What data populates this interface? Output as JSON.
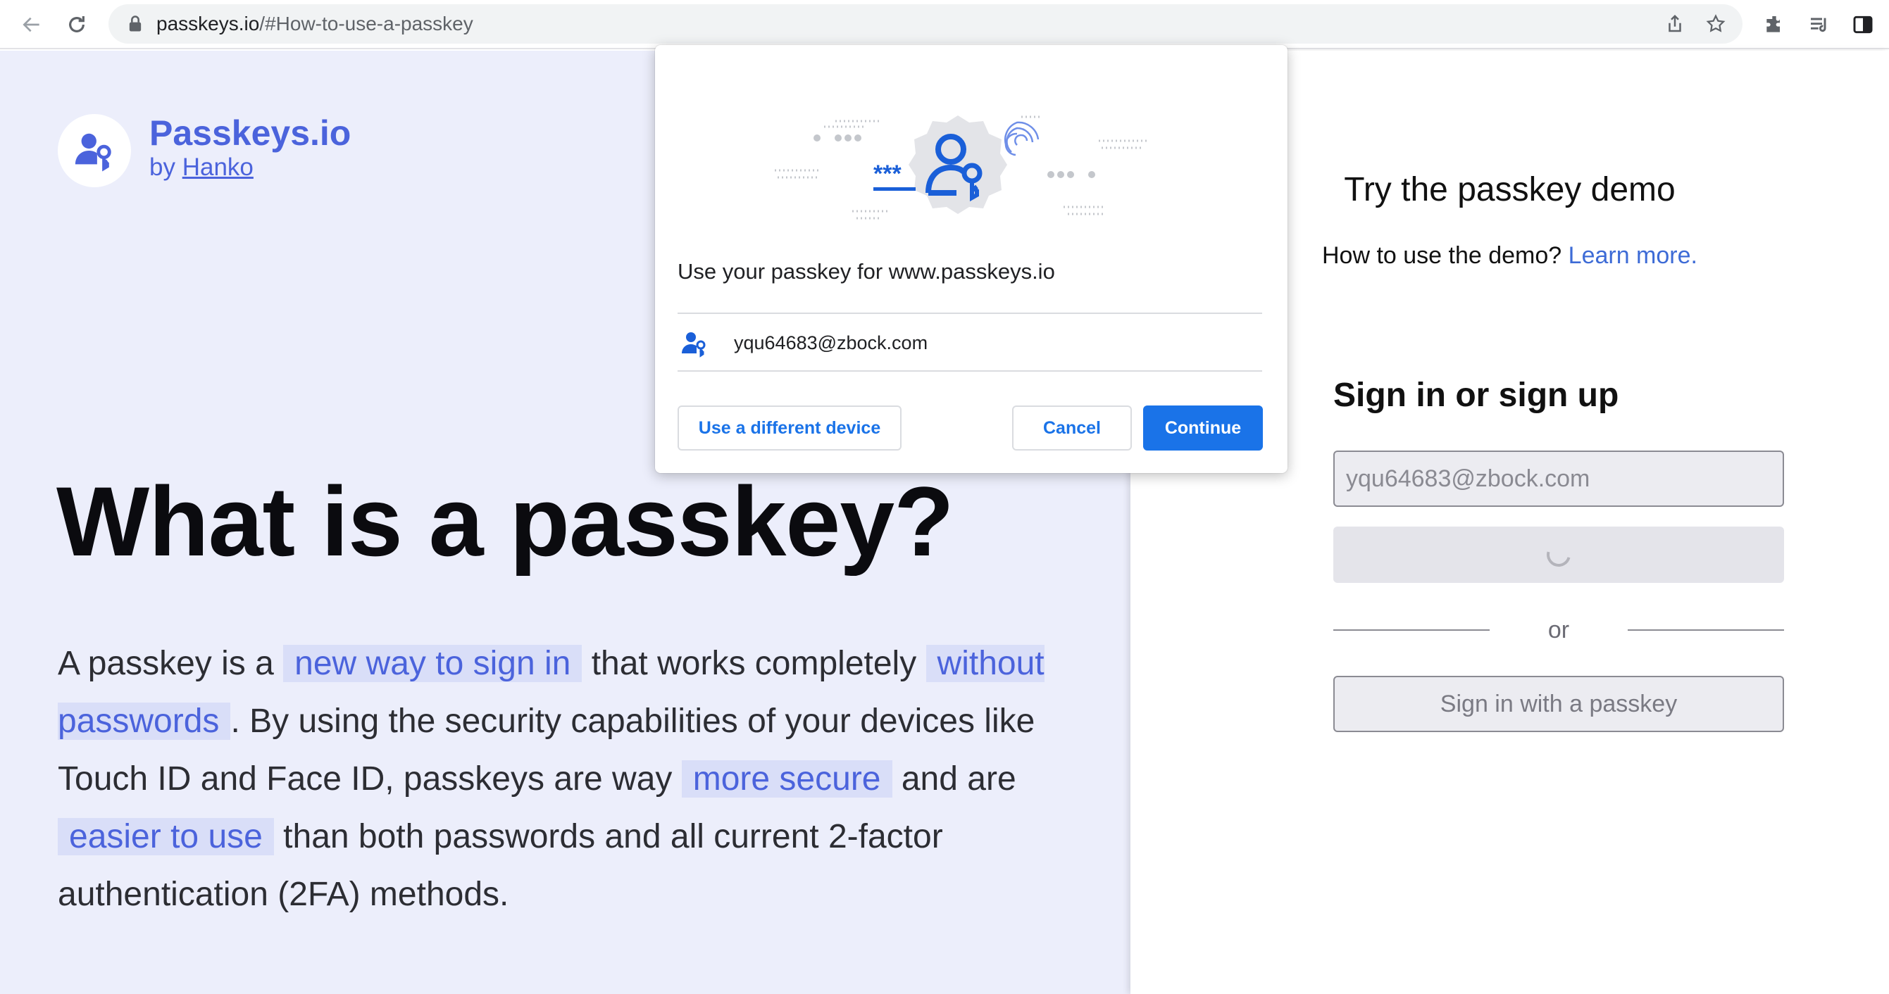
{
  "browser": {
    "url_host": "passkeys.io",
    "url_path": "/#How-to-use-a-passkey",
    "icons": [
      "back-arrow-icon",
      "reload-icon",
      "lock-icon",
      "share-icon",
      "bookmark-star-icon",
      "extensions-icon",
      "reading-list-icon",
      "side-panel-icon"
    ]
  },
  "brand": {
    "name": "Passkeys.io",
    "by_prefix": "by",
    "by_link": "Hanko",
    "color": "#4b63dc"
  },
  "hero": {
    "headline": "What is a passkey?",
    "para": {
      "t1": "A passkey is a ",
      "h1": "new way to sign in",
      "t2": " that works completely ",
      "h2": "without passwords",
      "t3": ". By using the security capabilities of your devices like Touch ID and Face ID, passkeys are way ",
      "h3": "more secure",
      "t4": " and are ",
      "h4": "easier to use",
      "t5": " than both passwords and all current 2-factor authentication (2FA) methods."
    }
  },
  "demo": {
    "title": "Try the passkey demo",
    "subtitle": "How to use the demo?",
    "learn_more": "Learn more.",
    "signin_title": "Sign in or sign up",
    "email_placeholder": "yqu64683@zbock.com",
    "or_label": "or",
    "passkey_button": "Sign in with a passkey"
  },
  "dialog": {
    "title": "Use your passkey for www.passkeys.io",
    "account_email": "yqu64683@zbock.com",
    "different_device": "Use a different device",
    "cancel": "Cancel",
    "continue": "Continue",
    "accent": "#1a73e8"
  }
}
